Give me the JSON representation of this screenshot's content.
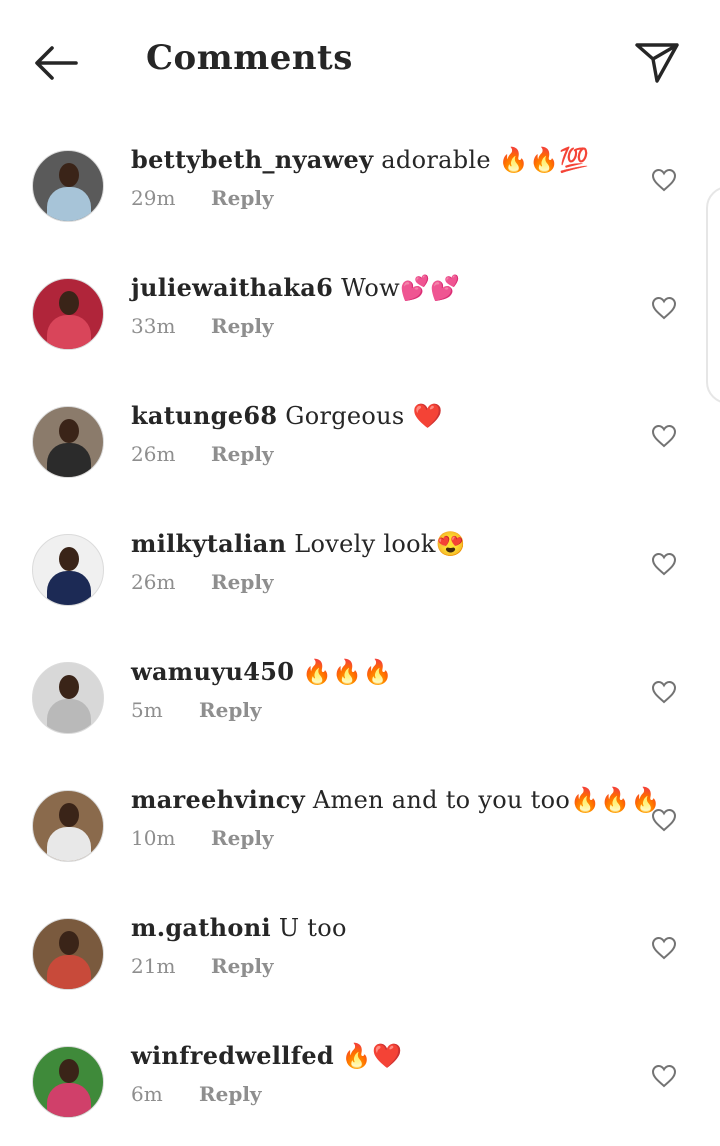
{
  "header": {
    "title": "Comments",
    "back_icon": "arrow-left-icon",
    "share_icon": "paper-plane-icon"
  },
  "comments": [
    {
      "username": "bettybeth_nyawey",
      "text": " adorable 🔥🔥💯",
      "time": "29m",
      "reply": "Reply",
      "avatar_colors": [
        "#5a5a5a",
        "#a7c4d8"
      ]
    },
    {
      "username": "juliewaithaka6",
      "text": " Wow💕💕",
      "time": "33m",
      "reply": "Reply",
      "avatar_colors": [
        "#b0253a",
        "#d9455a"
      ]
    },
    {
      "username": "katunge68",
      "text": " Gorgeous ❤️",
      "time": "26m",
      "reply": "Reply",
      "avatar_colors": [
        "#8b7b6b",
        "#2b2b2b"
      ]
    },
    {
      "username": "milkytalian",
      "text": " Lovely look😍",
      "time": "26m",
      "reply": "Reply",
      "avatar_colors": [
        "#f0f0f0",
        "#1c2a55"
      ]
    },
    {
      "username": "wamuyu450",
      "text": " 🔥🔥🔥",
      "time": "5m",
      "reply": "Reply",
      "avatar_colors": [
        "#d8d8d8",
        "#b9b9b9"
      ]
    },
    {
      "username": "mareehvincy",
      "text": " Amen and to you too🔥🔥🔥",
      "time": "10m",
      "reply": "Reply",
      "avatar_colors": [
        "#8a6a4c",
        "#e8e8e8"
      ]
    },
    {
      "username": "m.gathoni",
      "text": " U too",
      "time": "21m",
      "reply": "Reply",
      "avatar_colors": [
        "#7a5a3e",
        "#c84a3a"
      ]
    },
    {
      "username": "winfredwellfed",
      "text": " 🔥❤️",
      "time": "6m",
      "reply": "Reply",
      "avatar_colors": [
        "#3f8a3a",
        "#d0406a"
      ]
    }
  ],
  "like_icon": "heart-outline-icon"
}
